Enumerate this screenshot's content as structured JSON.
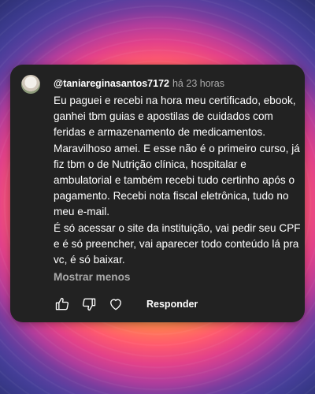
{
  "comment": {
    "username": "@taniareginasantos7172",
    "time": "há 23 horas",
    "paragraphs": [
      "Eu paguei e recebi na hora meu certificado, ebook, ganhei tbm guias e apostilas de cuidados com feridas e armazenamento de medicamentos. Maravilhoso amei. E esse não é o primeiro curso, já fiz tbm o de Nutrição clínica, hospitalar e ambulatorial e também recebi tudo certinho após o pagamento. Recebi nota fiscal eletrônica, tudo no meu e-mail.",
      "É só acessar o site da instituição, vai pedir seu CPF e é  só preencher, vai aparecer todo conteúdo lá pra vc, é só baixar."
    ],
    "show_less": "Mostrar menos",
    "reply_label": "Responder"
  },
  "icons": {
    "like": "thumbs-up-icon",
    "dislike": "thumbs-down-icon",
    "heart": "heart-icon"
  },
  "colors": {
    "card_bg": "#222222",
    "text": "#ffffff",
    "muted": "#aaaaaa"
  }
}
